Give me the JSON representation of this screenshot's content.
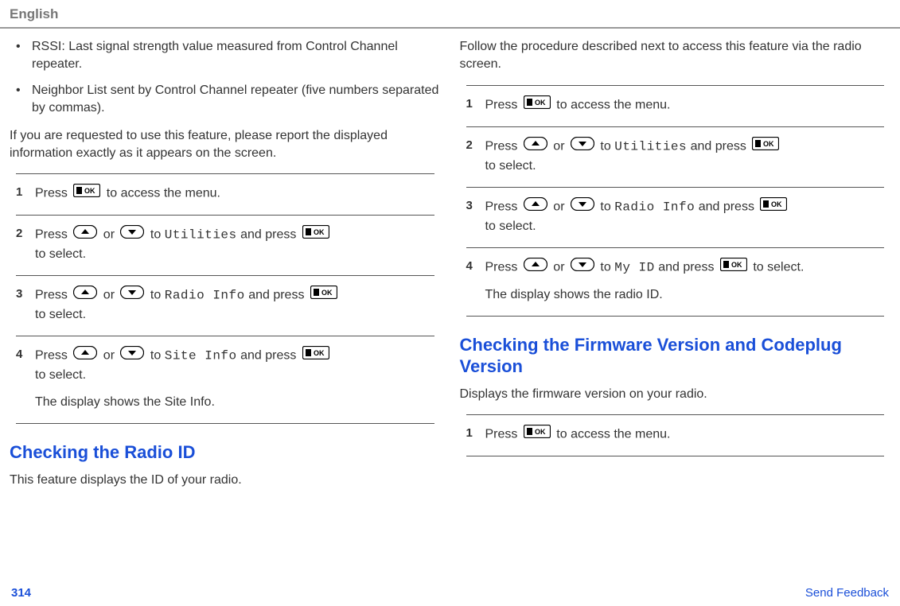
{
  "header": {
    "language": "English"
  },
  "col1": {
    "bullets": [
      "RSSI: Last signal strength value measured from Control Channel repeater.",
      "Neighbor List sent by Control Channel repeater (five numbers separated by commas)."
    ],
    "intro": "If you are requested to use this feature, please report the displayed information exactly as it appears on the screen.",
    "steps": [
      {
        "num": "1",
        "pre": "Press ",
        "mid": " to access the menu.",
        "icons": [
          "ok"
        ]
      },
      {
        "num": "2",
        "pre": "Press ",
        "or": " or ",
        "to": " to ",
        "menu": "Utilities",
        "andpress": " and press ",
        "tail": "to select.",
        "icons": [
          "up",
          "down",
          "ok"
        ]
      },
      {
        "num": "3",
        "pre": "Press ",
        "or": " or ",
        "to": " to ",
        "menu": "Radio Info",
        "andpress": " and press ",
        "tail": "to select.",
        "icons": [
          "up",
          "down",
          "ok"
        ]
      },
      {
        "num": "4",
        "pre": "Press ",
        "or": " or ",
        "to": " to ",
        "menu": "Site Info",
        "andpress": " and press ",
        "tail": "to select.",
        "result": "The display shows the Site Info.",
        "icons": [
          "up",
          "down",
          "ok"
        ]
      }
    ],
    "heading1": "Checking the Radio ID",
    "heading1_desc": "This feature displays the ID of your radio."
  },
  "col2": {
    "intro": "Follow the procedure described next to access this feature via the radio screen.",
    "steps": [
      {
        "num": "1",
        "pre": "Press ",
        "mid": " to access the menu.",
        "icons": [
          "ok"
        ]
      },
      {
        "num": "2",
        "pre": "Press ",
        "or": " or ",
        "to": " to ",
        "menu": "Utilities",
        "andpress": " and press ",
        "tail": "to select.",
        "icons": [
          "up",
          "down",
          "ok"
        ]
      },
      {
        "num": "3",
        "pre": "Press ",
        "or": " or ",
        "to": " to ",
        "menu": "Radio Info",
        "andpress": " and press ",
        "tail": "to select.",
        "icons": [
          "up",
          "down",
          "ok"
        ]
      },
      {
        "num": "4",
        "pre": "Press ",
        "or": " or ",
        "to": " to ",
        "menu": "My ID",
        "andpress": " and press ",
        "tail": " to select.",
        "result": "The display shows the radio ID.",
        "icons": [
          "up",
          "down",
          "ok"
        ],
        "inline_tail": true
      }
    ],
    "heading2": "Checking the Firmware Version and Codeplug Version",
    "heading2_desc": "Displays the firmware version on your radio.",
    "steps2": [
      {
        "num": "1",
        "pre": "Press ",
        "mid": " to access the menu.",
        "icons": [
          "ok"
        ]
      }
    ]
  },
  "footer": {
    "page": "314",
    "feedback": "Send Feedback"
  }
}
